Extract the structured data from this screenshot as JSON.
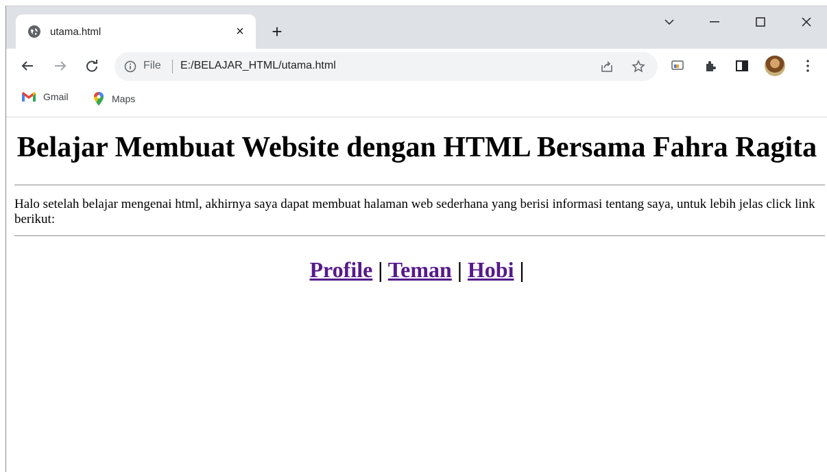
{
  "browser": {
    "tab": {
      "title": "utama.html",
      "close": "×"
    },
    "new_tab": "+",
    "omnibox": {
      "scheme_label": "File",
      "url": "E:/BELAJAR_HTML/utama.html"
    },
    "bookmarks": [
      {
        "label": "Gmail",
        "icon": "gmail-icon"
      },
      {
        "label": "Maps",
        "icon": "maps-icon"
      }
    ]
  },
  "page": {
    "heading": "Belajar Membuat Website dengan HTML Bersama Fahra Ragita",
    "intro": "Halo setelah belajar mengenai html, akhirnya saya dapat membuat halaman web sederhana yang berisi informasi tentang saya, untuk lebih jelas click link berikut:",
    "links": [
      {
        "label": "Profile"
      },
      {
        "label": "Teman"
      },
      {
        "label": "Hobi"
      }
    ],
    "separator": "|"
  },
  "colors": {
    "link_visited": "#551a8b",
    "tabstrip": "#dee1e6",
    "omnibox": "#f1f3f4"
  }
}
